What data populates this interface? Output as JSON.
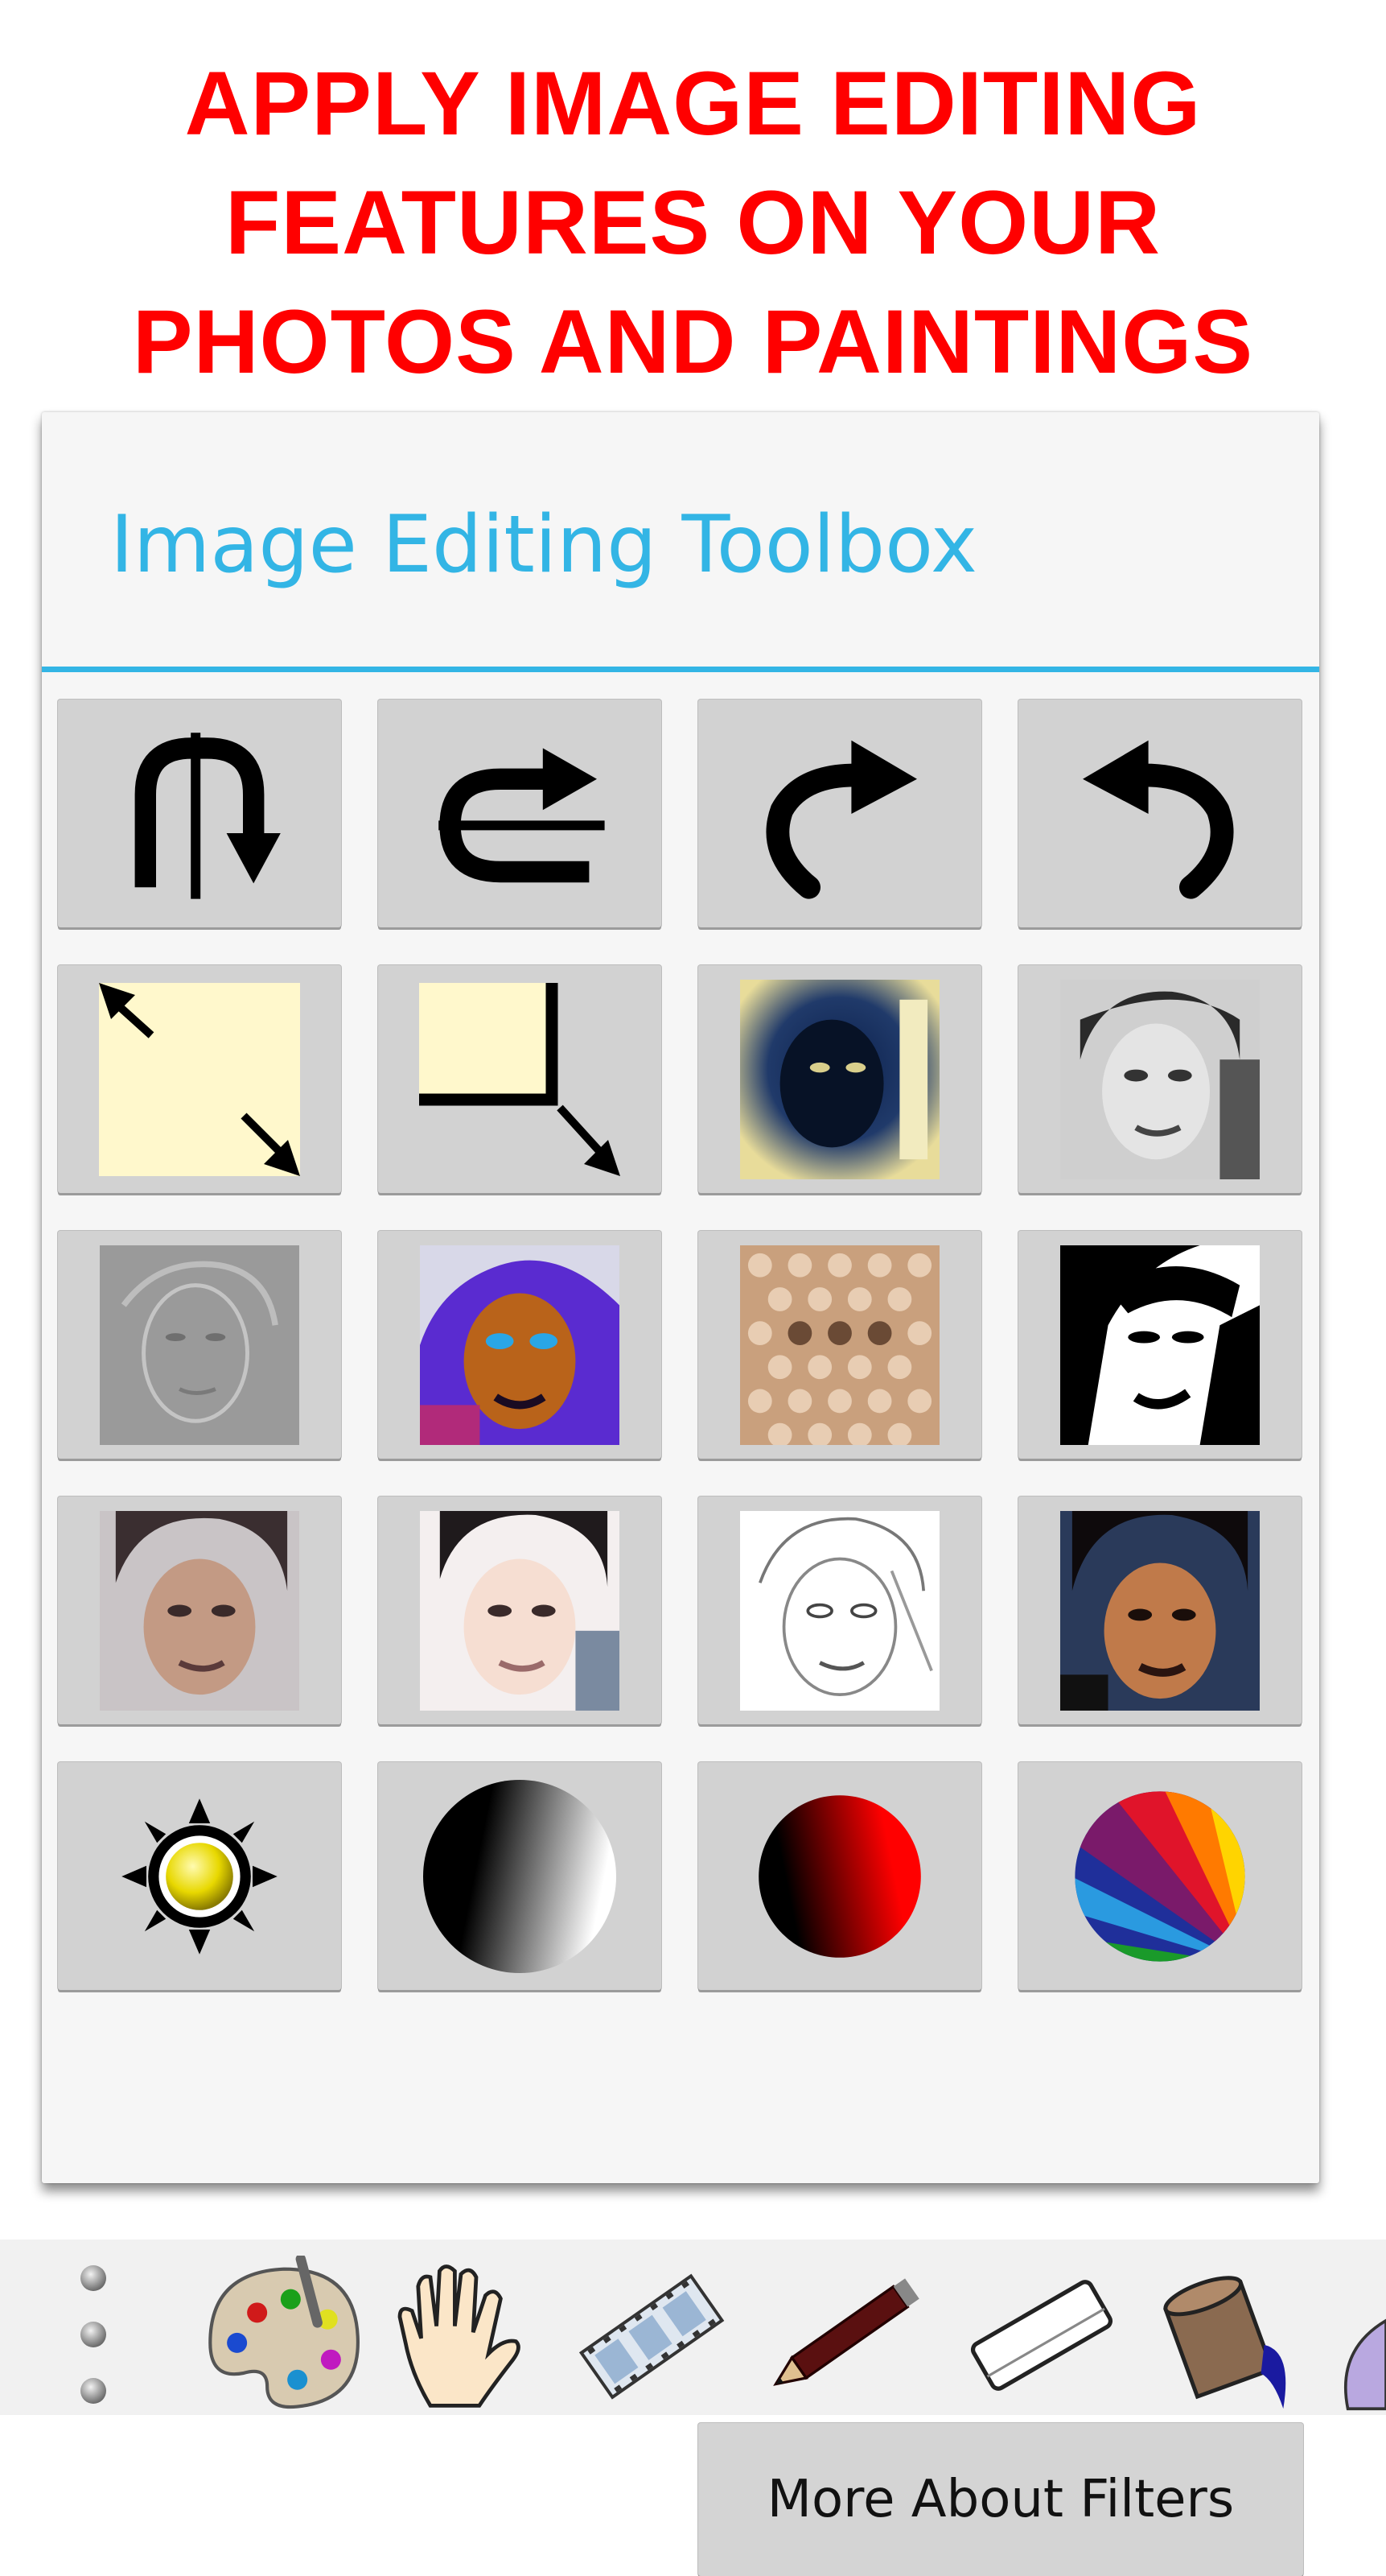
{
  "headline": {
    "lines": [
      "APPLY IMAGE EDITING",
      "FEATURES ON YOUR",
      "PHOTOS AND PAINTINGS"
    ],
    "color": "#ff0000"
  },
  "dialog": {
    "title": "Image Editing Toolbox",
    "accent": "#33b5e5",
    "tools": [
      {
        "icon": "flip-vertical-icon"
      },
      {
        "icon": "flip-horizontal-icon"
      },
      {
        "icon": "rotate-right-icon"
      },
      {
        "icon": "rotate-left-icon"
      },
      {
        "icon": "resize-icon"
      },
      {
        "icon": "crop-icon"
      },
      {
        "icon": "invert-filter-icon"
      },
      {
        "icon": "grayscale-filter-icon"
      },
      {
        "icon": "emboss-filter-icon"
      },
      {
        "icon": "color-boost-filter-icon"
      },
      {
        "icon": "pixelate-filter-icon"
      },
      {
        "icon": "black-white-filter-icon"
      },
      {
        "icon": "soft-tone-filter-icon"
      },
      {
        "icon": "brighten-filter-icon"
      },
      {
        "icon": "sketch-filter-icon"
      },
      {
        "icon": "saturate-filter-icon"
      },
      {
        "icon": "brightness-icon"
      },
      {
        "icon": "contrast-icon"
      },
      {
        "icon": "red-tint-icon"
      },
      {
        "icon": "color-balance-icon"
      }
    ],
    "more_button": "More About Filters"
  },
  "toolbar": {
    "items": [
      "overflow-menu-icon",
      "palette-icon",
      "hand-icon",
      "film-icon",
      "pencil-icon",
      "eraser-icon",
      "paint-bucket-icon"
    ]
  }
}
